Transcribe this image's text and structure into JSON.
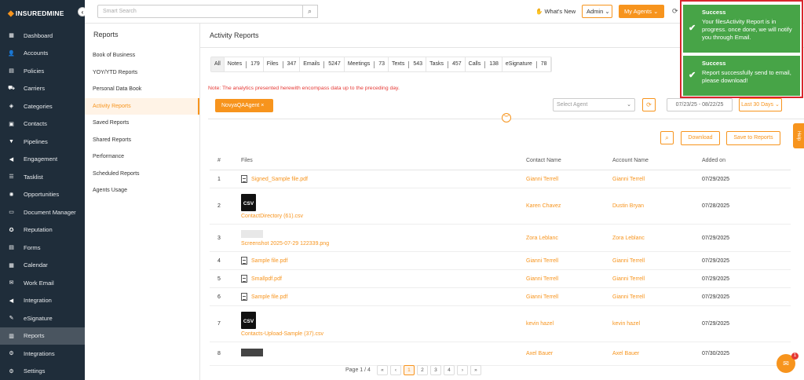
{
  "app": {
    "brand": "INSUREDMINE"
  },
  "sidebar": {
    "items": [
      {
        "label": "Dashboard",
        "icon": "dashboard-icon",
        "glyph": "▦"
      },
      {
        "label": "Accounts",
        "icon": "accounts-icon",
        "glyph": "👤"
      },
      {
        "label": "Policies",
        "icon": "policies-icon",
        "glyph": "▤"
      },
      {
        "label": "Carriers",
        "icon": "carriers-icon",
        "glyph": "⛟"
      },
      {
        "label": "Categories",
        "icon": "categories-icon",
        "glyph": "◈"
      },
      {
        "label": "Contacts",
        "icon": "contacts-icon",
        "glyph": "▣"
      },
      {
        "label": "Pipelines",
        "icon": "pipelines-icon",
        "glyph": "▼"
      },
      {
        "label": "Engagement",
        "icon": "engagement-icon",
        "glyph": "◀"
      },
      {
        "label": "Tasklist",
        "icon": "tasklist-icon",
        "glyph": "☰"
      },
      {
        "label": "Opportunities",
        "icon": "opportunities-icon",
        "glyph": "✺"
      },
      {
        "label": "Document Manager",
        "icon": "folder-icon",
        "glyph": "▭"
      },
      {
        "label": "Reputation",
        "icon": "reputation-icon",
        "glyph": "✪"
      },
      {
        "label": "Forms",
        "icon": "forms-icon",
        "glyph": "▤"
      },
      {
        "label": "Calendar",
        "icon": "calendar-icon",
        "glyph": "▦"
      },
      {
        "label": "Work Email",
        "icon": "email-icon",
        "glyph": "✉"
      },
      {
        "label": "Integration",
        "icon": "integration-icon",
        "glyph": "◀"
      },
      {
        "label": "eSignature",
        "icon": "esignature-icon",
        "glyph": "✎"
      },
      {
        "label": "Reports",
        "icon": "reports-icon",
        "glyph": "▥"
      },
      {
        "label": "Integrations",
        "icon": "integrations-icon",
        "glyph": "⚙"
      },
      {
        "label": "Settings",
        "icon": "settings-icon",
        "glyph": "⚙"
      }
    ],
    "active_index": 17
  },
  "topbar": {
    "search_placeholder": "Smart Search",
    "whats_new": "What's New",
    "admin": "Admin",
    "my_agents": "My Agents"
  },
  "subpanel": {
    "title": "Reports",
    "items": [
      "Book of Business",
      "YOY/YTD Reports",
      "Personal Data Book",
      "Activity Reports",
      "Saved Reports",
      "Shared Reports",
      "Performance",
      "Scheduled Reports",
      "Agents Usage"
    ],
    "active_index": 3
  },
  "main": {
    "title": "Activity Reports",
    "filters": [
      {
        "label": "All",
        "count": ""
      },
      {
        "label": "Notes",
        "count": "179"
      },
      {
        "label": "Files",
        "count": "347"
      },
      {
        "label": "Emails",
        "count": "5247"
      },
      {
        "label": "Meetings",
        "count": "73"
      },
      {
        "label": "Texts",
        "count": "543"
      },
      {
        "label": "Tasks",
        "count": "457"
      },
      {
        "label": "Calls",
        "count": "138"
      },
      {
        "label": "eSignature",
        "count": "78"
      }
    ],
    "note": "Note: The analytics presented herewith encompass data up to the preceding day.",
    "chip": "NovyaQAAgent ×",
    "agent_placeholder": "Select Agent",
    "date_range": "07/23/25 - 08/22/25",
    "range_preset": "Last 30 Days",
    "download": "Download",
    "save": "Save to Reports",
    "columns": [
      "#",
      "Files",
      "Contact Name",
      "Account Name",
      "Added on"
    ],
    "rows": [
      {
        "n": "1",
        "type": "pdf",
        "file": "Signed_Sample file.pdf",
        "contact": "Gianni Terrell",
        "account": "Gianni Terrell",
        "date": "07/29/2025"
      },
      {
        "n": "2",
        "type": "csv",
        "file": "ContactDirectory (61).csv",
        "contact": "Karen Chavez",
        "account": "Dustin Bryan",
        "date": "07/28/2025"
      },
      {
        "n": "3",
        "type": "img",
        "file": "Screenshot 2025-07-29 122339.png",
        "contact": "Zora Leblanc",
        "account": "Zora Leblanc",
        "date": "07/29/2025"
      },
      {
        "n": "4",
        "type": "pdf",
        "file": "Sample file.pdf",
        "contact": "Gianni Terrell",
        "account": "Gianni Terrell",
        "date": "07/29/2025"
      },
      {
        "n": "5",
        "type": "pdf",
        "file": "Smallpdf.pdf",
        "contact": "Gianni Terrell",
        "account": "Gianni Terrell",
        "date": "07/29/2025"
      },
      {
        "n": "6",
        "type": "pdf",
        "file": "Sample file.pdf",
        "contact": "Gianni Terrell",
        "account": "Gianni Terrell",
        "date": "07/29/2025"
      },
      {
        "n": "7",
        "type": "csv",
        "file": "Contacts-Upload-Sample (37).csv",
        "contact": "kevin hazel",
        "account": "kevin hazel",
        "date": "07/29/2025"
      },
      {
        "n": "8",
        "type": "img2",
        "file": "",
        "contact": "Axel Bauer",
        "account": "Axel Bauer",
        "date": "07/30/2025"
      }
    ],
    "pager": {
      "label": "Page 1 / 4",
      "pages": [
        "«",
        "‹",
        "1",
        "2",
        "3",
        "4",
        "›",
        "»"
      ],
      "current": "1"
    }
  },
  "help": "Help",
  "chat_badge": "1",
  "toasts": [
    {
      "title": "Success",
      "message": "Your filesActivity Report is in progress. once done, we will notify you through Email."
    },
    {
      "title": "Success",
      "message": "Report successfully send to email, please download!"
    }
  ]
}
